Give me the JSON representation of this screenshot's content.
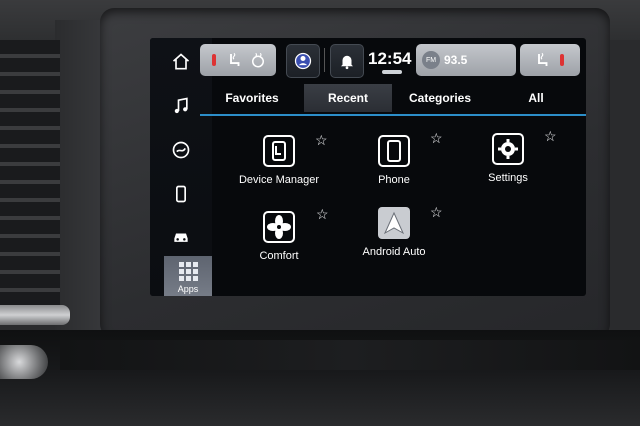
{
  "statusbar": {
    "time": "12:54",
    "radio": {
      "band": "FM",
      "frequency": "93.5"
    }
  },
  "tabs": [
    {
      "label": "Favorites"
    },
    {
      "label": "Recent"
    },
    {
      "label": "Categories"
    },
    {
      "label": "All"
    }
  ],
  "active_tab": "Recent",
  "apps": [
    {
      "label": "Device Manager",
      "icon": "device-manager-icon"
    },
    {
      "label": "Phone",
      "icon": "phone-icon"
    },
    {
      "label": "Settings",
      "icon": "gear-icon"
    },
    {
      "label": "Comfort",
      "icon": "fan-icon"
    },
    {
      "label": "Android Auto",
      "icon": "android-auto-icon"
    }
  ],
  "sidebar": {
    "items": [
      {
        "icon": "home-icon"
      },
      {
        "icon": "music-note-icon"
      },
      {
        "icon": "climate-icon"
      },
      {
        "icon": "phone-icon"
      },
      {
        "icon": "car-icon"
      }
    ],
    "apps_label": "Apps"
  },
  "colors": {
    "accent": "#2c8ec9",
    "screen_bg": "#07090c"
  }
}
